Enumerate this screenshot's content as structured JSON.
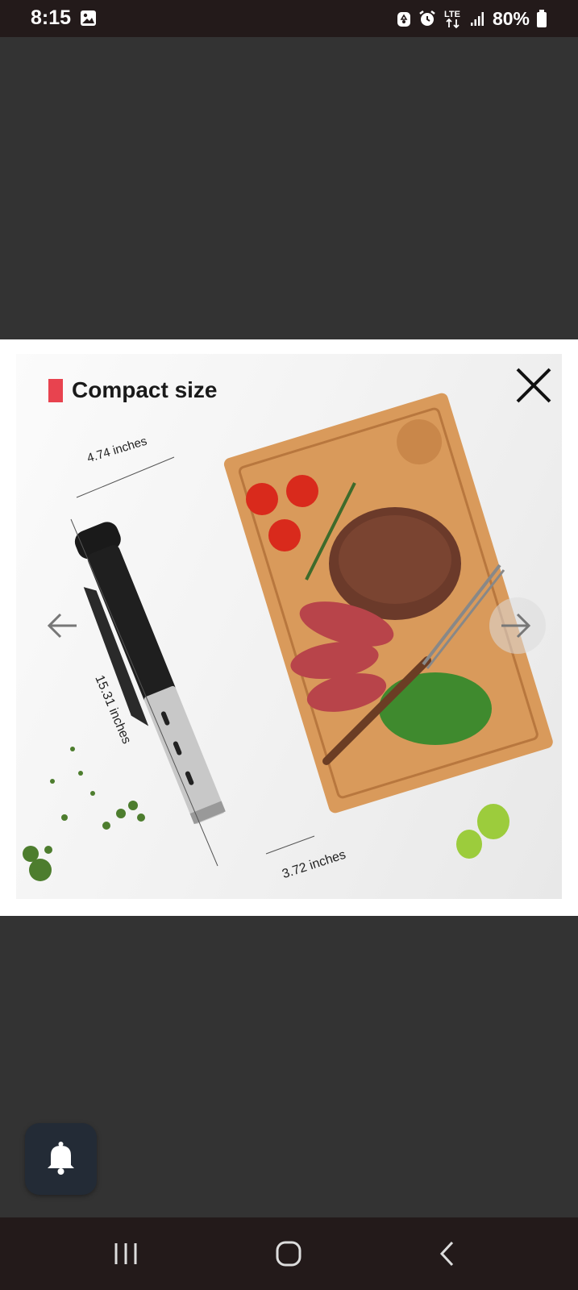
{
  "status_bar": {
    "time": "8:15",
    "network": "LTE",
    "battery": "80%",
    "icons": [
      "gallery-icon",
      "recycle-icon",
      "alarm-icon",
      "lte-icon",
      "signal-icon",
      "battery-icon"
    ]
  },
  "modal": {
    "headline": "Compact size",
    "accent_color": "#e8434f",
    "dimensions": {
      "width": "4.74 inches",
      "height": "15.31 inches",
      "base": "3.72 inches"
    },
    "icons": [
      "close-icon",
      "arrow-left-icon",
      "arrow-right-icon"
    ]
  },
  "floating": {
    "icon": "bell-icon"
  },
  "nav_bar": {
    "icons": [
      "recents-icon",
      "home-icon",
      "back-icon"
    ]
  }
}
